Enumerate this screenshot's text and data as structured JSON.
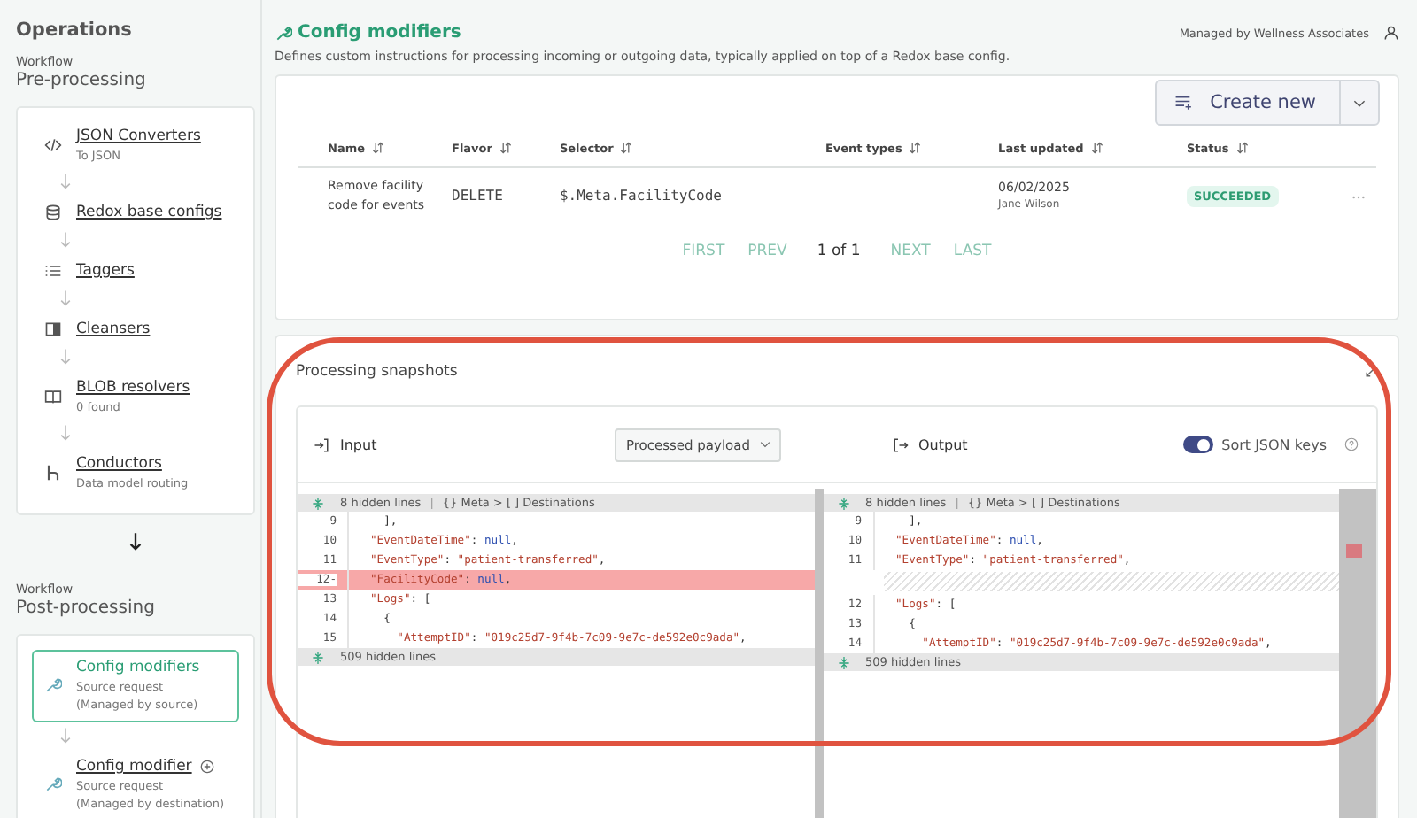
{
  "sidebar": {
    "title": "Operations",
    "workflows": [
      {
        "label": "Workflow",
        "name": "Pre-processing",
        "items": [
          {
            "kind": "code",
            "title": "JSON Converters",
            "subtitle": [
              "To JSON"
            ],
            "selected": false,
            "addable": false
          },
          {
            "kind": "database",
            "title": "Redox base configs",
            "selected": false,
            "addable": false
          },
          {
            "kind": "list",
            "title": "Taggers",
            "selected": false,
            "addable": false
          },
          {
            "kind": "panel",
            "title": "Cleansers",
            "selected": false,
            "addable": false
          },
          {
            "kind": "book",
            "title": "BLOB resolvers",
            "subtitle": [
              "0 found"
            ],
            "selected": false,
            "addable": false
          },
          {
            "kind": "branch",
            "title": "Conductors",
            "subtitle": [
              "Data model routing"
            ],
            "selected": false,
            "addable": false
          }
        ]
      },
      {
        "label": "Workflow",
        "name": "Post-processing",
        "items": [
          {
            "kind": "wrench",
            "title": "Config modifiers",
            "subtitle": [
              "Source request",
              "(Managed by source)"
            ],
            "selected": true,
            "addable": false
          },
          {
            "kind": "wrench",
            "title": "Config modifier",
            "subtitle": [
              "Source request",
              "(Managed by destination)"
            ],
            "selected": false,
            "addable": true
          }
        ]
      }
    ]
  },
  "header": {
    "title": "Config modifiers",
    "managed_by": "Managed by Wellness Associates",
    "description": "Defines custom instructions for processing incoming or outgoing data, typically applied on top of a Redox base config."
  },
  "create_button": "Create new",
  "table": {
    "columns": [
      "Name",
      "Flavor",
      "Selector",
      "Event types",
      "Last updated",
      "Status"
    ],
    "rows": [
      {
        "name": "Remove facility code for events",
        "flavor": "DELETE",
        "selector": "$.Meta.FacilityCode",
        "updated": "06/02/2025",
        "updated_by": "Jane Wilson",
        "status": "SUCCEEDED"
      }
    ]
  },
  "pagination": {
    "first": "FIRST",
    "prev": "PREV",
    "page": "1 of 1",
    "next": "NEXT",
    "last": "LAST"
  },
  "snapshots": {
    "title": "Processing snapshots",
    "input_label": "Input",
    "payload_select": "Processed payload",
    "output_label": "Output",
    "sort_label": "Sort JSON keys",
    "sort_on": true,
    "panes": [
      {
        "hidden_top": "8 hidden lines",
        "separator": "|",
        "breadcrumb": "{} Meta > [ ] Destinations",
        "hidden_bottom": "509 hidden lines",
        "lines": [
          {
            "kind": "normal",
            "number": "9",
            "tokens": [
              {
                "kind": "punct",
                "text": "  ],"
              }
            ]
          },
          {
            "kind": "normal",
            "number": "10",
            "tokens": [
              {
                "kind": "key",
                "text": "\"EventDateTime\""
              },
              {
                "kind": "punct",
                "text": ": "
              },
              {
                "kind": "literal",
                "text": "null"
              },
              {
                "kind": "punct",
                "text": ","
              }
            ]
          },
          {
            "kind": "normal",
            "number": "11",
            "tokens": [
              {
                "kind": "key",
                "text": "\"EventType\""
              },
              {
                "kind": "punct",
                "text": ": "
              },
              {
                "kind": "string",
                "text": "\"patient-transferred\""
              },
              {
                "kind": "punct",
                "text": ","
              }
            ]
          },
          {
            "kind": "removed",
            "number": "12",
            "marker": "-",
            "tokens": [
              {
                "kind": "key",
                "text": "\"FacilityCode\""
              },
              {
                "kind": "punct",
                "text": ": "
              },
              {
                "kind": "literal",
                "text": "null"
              },
              {
                "kind": "punct",
                "text": ","
              }
            ]
          },
          {
            "kind": "normal",
            "number": "13",
            "tokens": [
              {
                "kind": "key",
                "text": "\"Logs\""
              },
              {
                "kind": "punct",
                "text": ": ["
              }
            ]
          },
          {
            "kind": "normal",
            "number": "14",
            "tokens": [
              {
                "kind": "punct",
                "text": "  {"
              }
            ]
          },
          {
            "kind": "normal",
            "number": "15",
            "tokens": [
              {
                "kind": "key",
                "text": "    \"AttemptID\""
              },
              {
                "kind": "punct",
                "text": ": "
              },
              {
                "kind": "string",
                "text": "\"019c25d7-9f4b-7c09-9e7c-de592e0c9ada\""
              },
              {
                "kind": "punct",
                "text": ","
              }
            ]
          }
        ]
      },
      {
        "hidden_top": "8 hidden lines",
        "separator": "|",
        "breadcrumb": "{} Meta > [ ] Destinations",
        "hidden_bottom": "509 hidden lines",
        "lines": [
          {
            "kind": "normal",
            "number": "9",
            "tokens": [
              {
                "kind": "punct",
                "text": "  ],"
              }
            ]
          },
          {
            "kind": "normal",
            "number": "10",
            "tokens": [
              {
                "kind": "key",
                "text": "\"EventDateTime\""
              },
              {
                "kind": "punct",
                "text": ": "
              },
              {
                "kind": "literal",
                "text": "null"
              },
              {
                "kind": "punct",
                "text": ","
              }
            ]
          },
          {
            "kind": "normal",
            "number": "11",
            "tokens": [
              {
                "kind": "key",
                "text": "\"EventType\""
              },
              {
                "kind": "punct",
                "text": ": "
              },
              {
                "kind": "string",
                "text": "\"patient-transferred\""
              },
              {
                "kind": "punct",
                "text": ","
              }
            ]
          },
          {
            "kind": "gap"
          },
          {
            "kind": "normal",
            "number": "12",
            "tokens": [
              {
                "kind": "key",
                "text": "\"Logs\""
              },
              {
                "kind": "punct",
                "text": ": ["
              }
            ]
          },
          {
            "kind": "normal",
            "number": "13",
            "tokens": [
              {
                "kind": "punct",
                "text": "  {"
              }
            ]
          },
          {
            "kind": "normal",
            "number": "14",
            "tokens": [
              {
                "kind": "key",
                "text": "    \"AttemptID\""
              },
              {
                "kind": "punct",
                "text": ": "
              },
              {
                "kind": "string",
                "text": "\"019c25d7-9f4b-7c09-9e7c-de592e0c9ada\""
              },
              {
                "kind": "punct",
                "text": ","
              }
            ]
          }
        ]
      }
    ]
  }
}
